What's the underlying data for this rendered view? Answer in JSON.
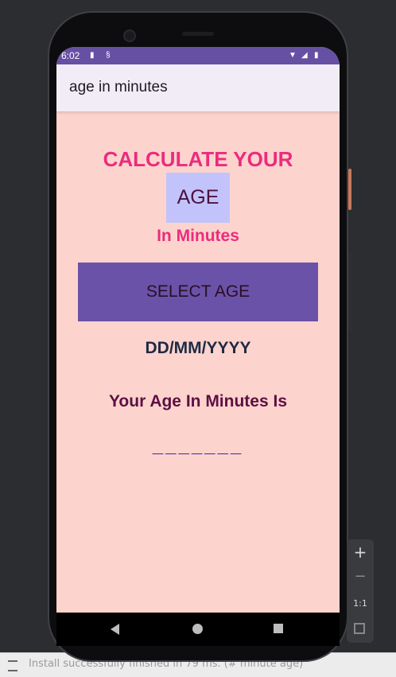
{
  "status_bar": {
    "time": "6:02",
    "icons": [
      "sim-icon",
      "sync-icon",
      "wifi-icon",
      "signal-icon",
      "battery-icon"
    ]
  },
  "app_bar": {
    "title": "age in minutes"
  },
  "main": {
    "heading_line1": "CALCULATE YOUR",
    "heading_line2": "AGE",
    "heading_line3": "In Minutes",
    "select_button_label": "SELECT AGE",
    "date_placeholder": "DD/MM/YYYY",
    "result_label": "Your Age In Minutes Is",
    "result_value": "_______"
  },
  "emulator_controls": {
    "zoom_in": "+",
    "zoom_out": "−",
    "actual_size": "1:1"
  },
  "ide_status": {
    "message": "Install successfully finished in 79 ms. (# minute age)"
  },
  "colors": {
    "status_bar": "#6650a4",
    "app_bar": "#f2ecf7",
    "screen_background": "#fcd4cd",
    "accent_pink": "#ec2b7d",
    "button": "#6a52a8",
    "age_box": "#c3c3fb"
  }
}
